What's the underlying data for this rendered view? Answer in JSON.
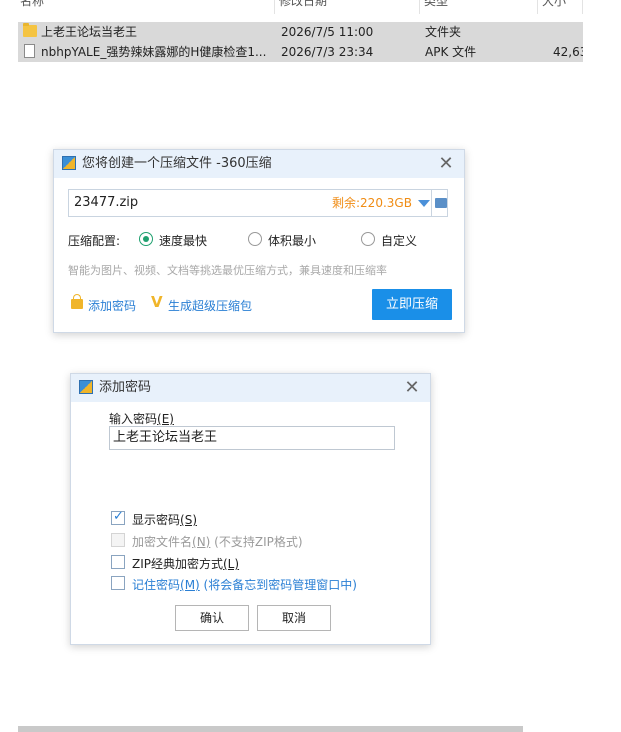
{
  "explorer": {
    "columns": [
      "名称",
      "修改日期",
      "类型",
      "大小"
    ],
    "files": [
      {
        "name": "上老王论坛当老王",
        "date": "2026/7/5 11:00",
        "type": "文件夹",
        "size": "",
        "icon": "folder-icon"
      },
      {
        "name": "nbhpYALE_强势辣妹露娜的H健康检查1...",
        "date": "2026/7/3 23:34",
        "type": "APK 文件",
        "size": "42,63",
        "icon": "file-icon"
      }
    ]
  },
  "zip_dialog": {
    "title": "您将创建一个压缩文件 -360压缩",
    "file_name": "23477.zip",
    "remaining": "剩余:220.3GB",
    "config_label": "压缩配置:",
    "options": [
      "速度最快",
      "体积最小",
      "自定义"
    ],
    "selected_option": "速度最快",
    "hint": "智能为图片、视频、文档等挑选最优压缩方式，兼具速度和压缩率",
    "add_password": "添加密码",
    "create_package": "生成超级压缩包",
    "compress_button": "立即压缩",
    "colors": {
      "accent": "#1a8fe8",
      "remaining": "#f08c14",
      "radio": "#1fa06f"
    }
  },
  "password_dialog": {
    "title": "添加密码",
    "input_label": "输入密码",
    "input_label_key": "(E)",
    "password_value": "上老王论坛当老王",
    "show_password": {
      "label": "显示密码",
      "key": "(S)",
      "checked": true
    },
    "encrypt_names": {
      "label": "加密文件名",
      "key": "(N)",
      "note": " (不支持ZIP格式)",
      "disabled": true
    },
    "zip_classic": {
      "label": "ZIP经典加密方式",
      "key": "(L)"
    },
    "remember": {
      "label": "记住密码",
      "key": "(M)",
      "note": " (将会备忘到密码管理窗口中)"
    },
    "ok": "确认",
    "cancel": "取消"
  }
}
